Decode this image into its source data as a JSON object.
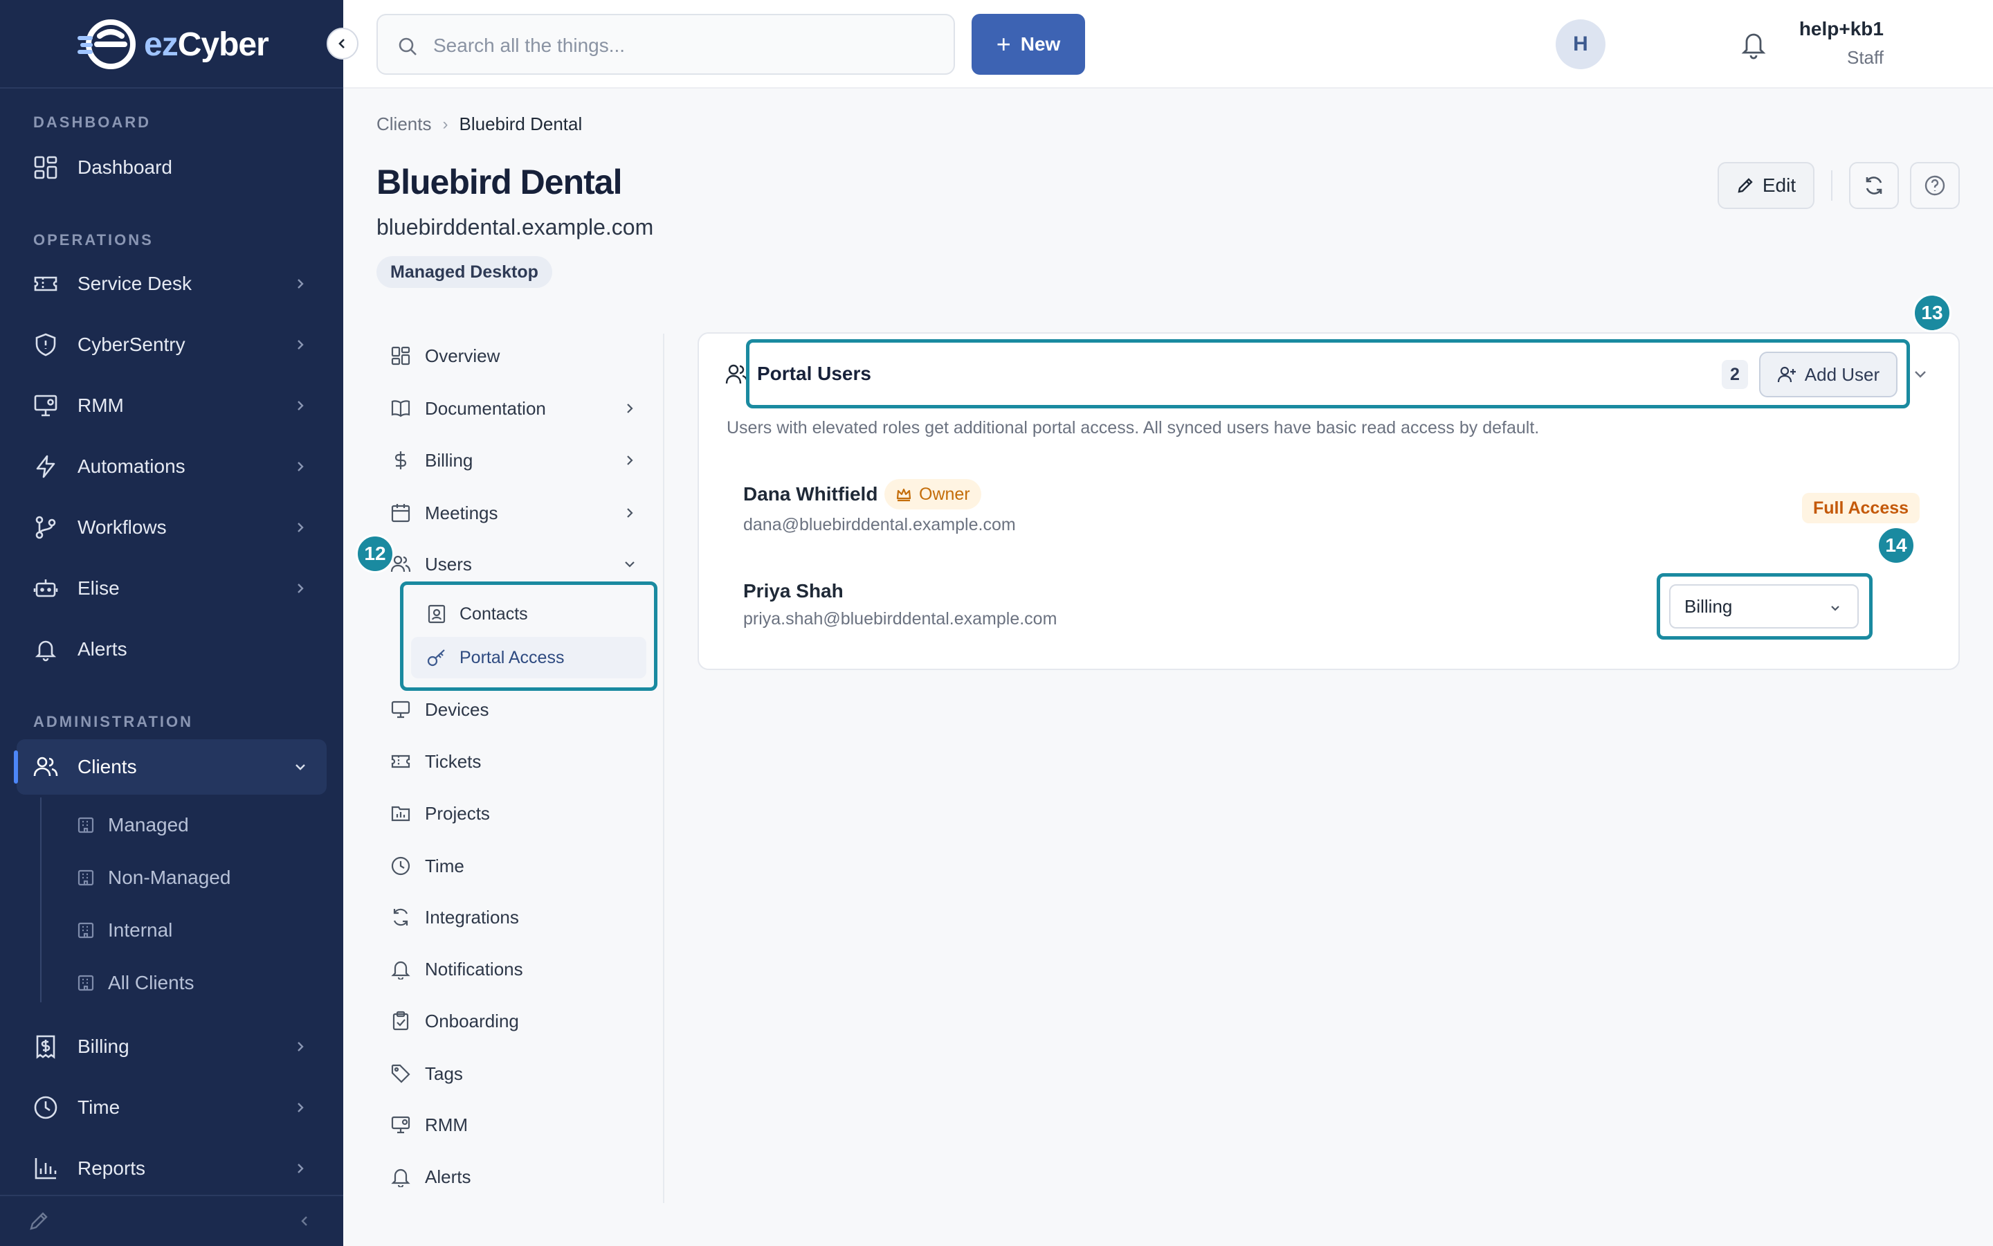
{
  "app": {
    "name": "ezCyber",
    "brand_prefix": "ez",
    "brand_suffix": "Cyber",
    "accent_color": "#3d63b3",
    "sidebar_color": "#1b2a4e",
    "highlight_color": "#1a8aa0"
  },
  "sidebar": {
    "sections": {
      "dashboard": "DASHBOARD",
      "operations": "OPERATIONS",
      "administration": "ADMINISTRATION"
    },
    "items": {
      "dashboard": "Dashboard",
      "service_desk": "Service Desk",
      "cybersentry": "CyberSentry",
      "rmm": "RMM",
      "automations": "Automations",
      "workflows": "Workflows",
      "elise": "Elise",
      "alerts": "Alerts",
      "clients": "Clients",
      "billing": "Billing",
      "time": "Time",
      "reports": "Reports"
    },
    "clients_sub": {
      "managed": "Managed",
      "non_managed": "Non-Managed",
      "internal": "Internal",
      "all_clients": "All Clients"
    }
  },
  "topbar": {
    "search_placeholder": "Search all the things...",
    "new_label": "New",
    "user_name": "help+kb1",
    "user_role": "Staff",
    "avatar_initial": "H"
  },
  "breadcrumb": {
    "root": "Clients",
    "current": "Bluebird Dental"
  },
  "client": {
    "name": "Bluebird Dental",
    "domain": "bluebirddental.example.com",
    "plan": "Managed Desktop",
    "edit_label": "Edit"
  },
  "client_nav": {
    "overview": "Overview",
    "documentation": "Documentation",
    "billing": "Billing",
    "meetings": "Meetings",
    "users": "Users",
    "contacts": "Contacts",
    "portal_access": "Portal Access",
    "devices": "Devices",
    "tickets": "Tickets",
    "projects": "Projects",
    "time": "Time",
    "integrations": "Integrations",
    "notifications": "Notifications",
    "onboarding": "Onboarding",
    "tags": "Tags",
    "rmm": "RMM",
    "alerts": "Alerts"
  },
  "markers": {
    "users_nav": "12",
    "card_header": "13",
    "role_select": "14"
  },
  "portal_users": {
    "title": "Portal Users",
    "count": "2",
    "add_user_label": "Add User",
    "description": "Users with elevated roles get additional portal access. All synced users have basic read access by default.",
    "users": [
      {
        "name": "Dana Whitfield",
        "email": "dana@bluebirddental.example.com",
        "badge": "Owner",
        "access": "Full Access"
      },
      {
        "name": "Priya Shah",
        "email": "priya.shah@bluebirddental.example.com",
        "role": "Billing"
      }
    ]
  }
}
